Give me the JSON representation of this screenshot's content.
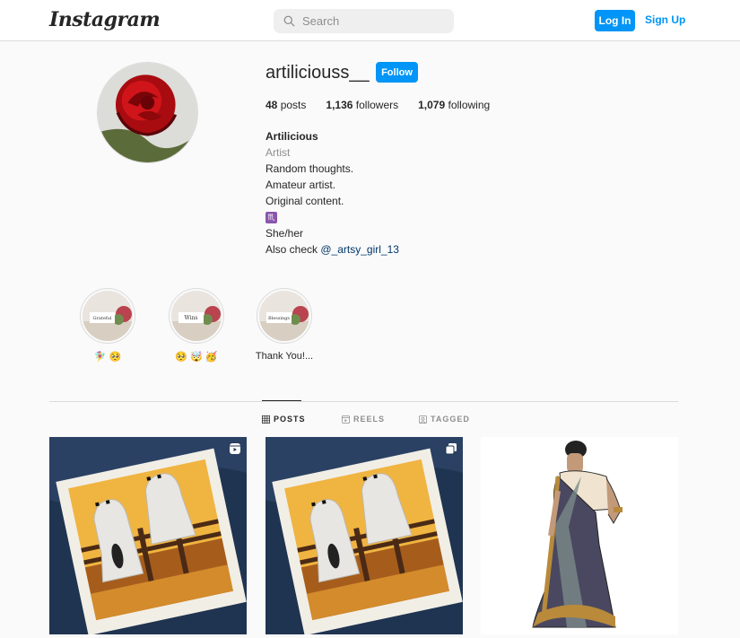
{
  "nav": {
    "logo": "Instagram",
    "search_placeholder": "Search",
    "login_label": "Log In",
    "signup_label": "Sign Up"
  },
  "profile": {
    "username": "artiliciouss__",
    "follow_label": "Follow",
    "stats": {
      "posts_count": "48",
      "posts_label": "posts",
      "followers_count": "1,136",
      "followers_label": "followers",
      "following_count": "1,079",
      "following_label": "following"
    },
    "bio": {
      "name": "Artilicious",
      "category": "Artist",
      "lines": [
        "Random thoughts.",
        "Amateur artist.",
        "Original content."
      ],
      "zodiac": "♏",
      "pronouns": "She/her",
      "also_check_prefix": "Also check ",
      "mention": "@_artsy_girl_13"
    }
  },
  "highlights": [
    {
      "label": "🧚‍♀️ 🥺",
      "cover_text": "Grateful"
    },
    {
      "label": "🥺 🤯 🥳",
      "cover_text": "Wins"
    },
    {
      "label": "Thank You!...",
      "cover_text": "Blessings"
    }
  ],
  "tabs": [
    {
      "label": "POSTS",
      "icon": "grid-icon",
      "active": true
    },
    {
      "label": "REELS",
      "icon": "reels-icon",
      "active": false
    },
    {
      "label": "TAGGED",
      "icon": "tagged-icon",
      "active": false
    }
  ],
  "posts": [
    {
      "icon": "reel-badge-icon"
    },
    {
      "icon": "carousel-badge-icon"
    },
    {
      "icon": ""
    }
  ],
  "colors": {
    "accent": "#0095f6",
    "text": "#262626",
    "muted": "#8e8e8e",
    "link": "#00376b",
    "border": "#dbdbdb",
    "background": "#fafafa"
  }
}
